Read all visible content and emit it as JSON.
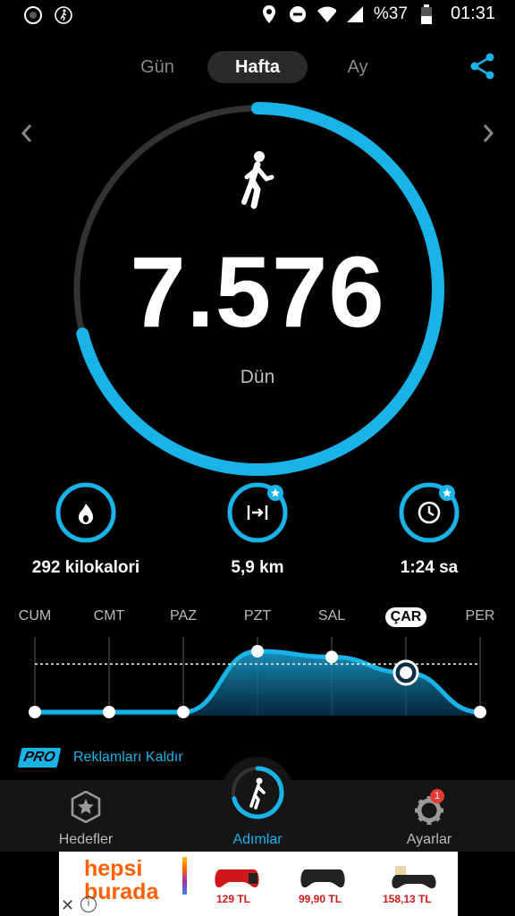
{
  "status_bar": {
    "battery_percent": "%37",
    "time": "01:31",
    "icons": [
      "app-circle-icon",
      "walking-icon",
      "location-icon",
      "do-not-disturb-icon",
      "wifi-icon",
      "signal-icon",
      "battery-icon"
    ]
  },
  "period_tabs": {
    "items": [
      {
        "label": "Gün",
        "selected": false
      },
      {
        "label": "Hafta",
        "selected": true
      },
      {
        "label": "Ay",
        "selected": false
      }
    ]
  },
  "progress": {
    "steps": "7.576",
    "day_label": "Dün",
    "goal_fraction": 0.71
  },
  "stats": [
    {
      "value": "292 kilokalori",
      "icon": "flame-icon",
      "starred": false
    },
    {
      "value": "5,9 km",
      "icon": "distance-icon",
      "starred": true
    },
    {
      "value": "1:24 sa",
      "icon": "clock-icon",
      "starred": true
    }
  ],
  "chart_data": {
    "type": "line",
    "categories": [
      "CUM",
      "CMT",
      "PAZ",
      "PZT",
      "SAL",
      "ÇAR",
      "PER"
    ],
    "selected_category": "ÇAR",
    "values": [
      0.05,
      0.05,
      0.05,
      0.9,
      0.82,
      0.6,
      0.05
    ],
    "goal_line": 0.72,
    "ylim": [
      0,
      1
    ],
    "grid": true
  },
  "pro": {
    "badge": "PRO",
    "label": "Reklamları Kaldır"
  },
  "bottom_nav": {
    "items": [
      {
        "label": "Hedefler",
        "icon": "star-badge-icon"
      },
      {
        "label": "Adımlar",
        "icon": "walking-icon",
        "active": true
      },
      {
        "label": "Ayarlar",
        "icon": "gear-icon",
        "badge": "1"
      }
    ]
  },
  "ad": {
    "brand_line1": "hepsi",
    "brand_line2": "burada",
    "prices": [
      "129 TL",
      "99,90 TL",
      "158,13 TL"
    ],
    "colors": {
      "brand_orange": "#ff6000"
    }
  },
  "colors": {
    "accent": "#1ab3e8",
    "track": "#333333"
  }
}
